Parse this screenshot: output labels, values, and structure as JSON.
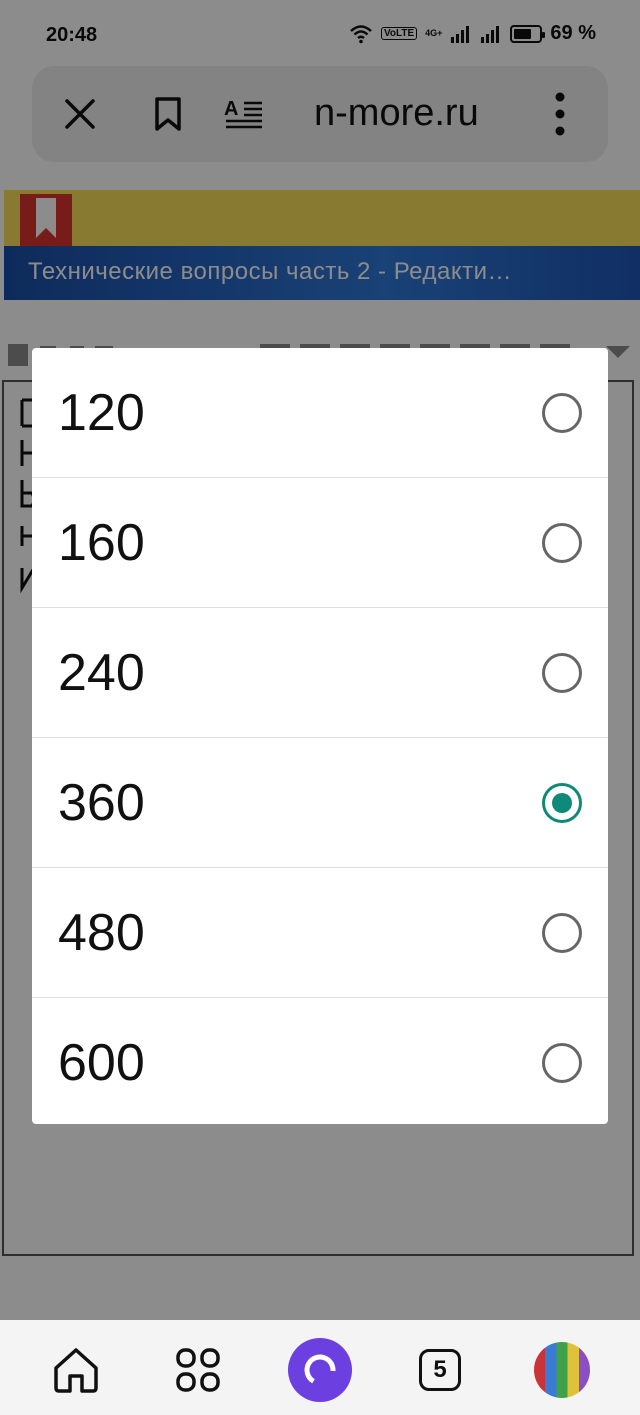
{
  "status_bar": {
    "time": "20:48",
    "volte": "VoLTE",
    "network": "4G+",
    "battery": "69 %",
    "battery_level": 0.69
  },
  "browser": {
    "url": "n-more.ru",
    "close_icon": "close-icon",
    "bookmark_icon": "bookmark-icon",
    "reader_icon": "reader-mode-icon",
    "menu_icon": "more-vertical-icon"
  },
  "page": {
    "banner_title": "Технические вопросы часть 2 - Редакти…"
  },
  "dialog": {
    "options": [
      {
        "label": "120",
        "selected": false
      },
      {
        "label": "160",
        "selected": false
      },
      {
        "label": "240",
        "selected": false
      },
      {
        "label": "360",
        "selected": true
      },
      {
        "label": "480",
        "selected": false
      },
      {
        "label": "600",
        "selected": false
      }
    ],
    "accent_color": "#0f8a78"
  },
  "bottom_nav": {
    "tabs_count": "5",
    "items": [
      "home-icon",
      "services-grid-icon",
      "alice-assistant-icon",
      "tabs-icon",
      "profile-avatar"
    ]
  }
}
